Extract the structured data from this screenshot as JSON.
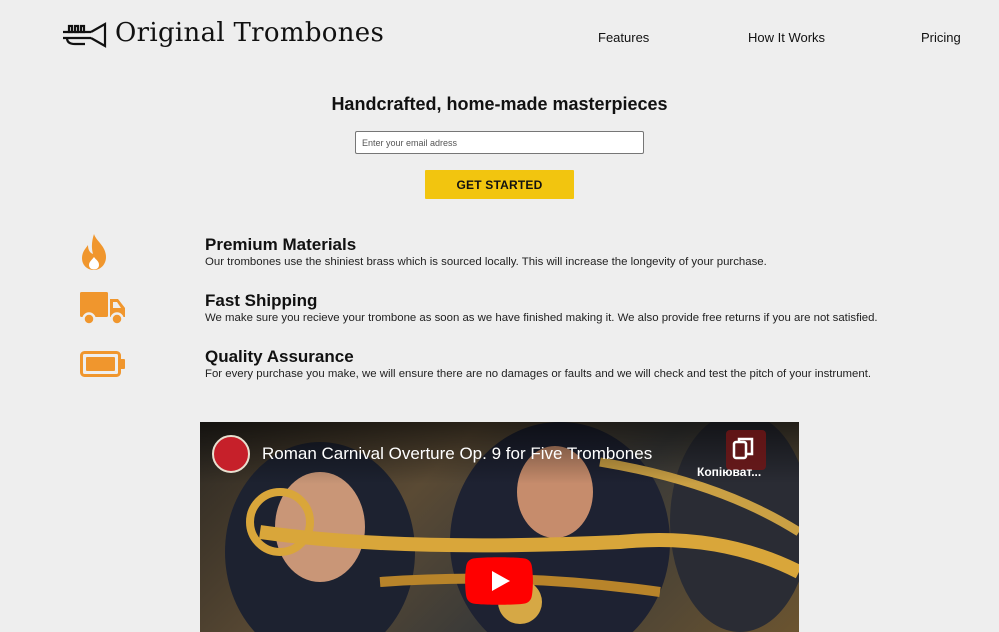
{
  "header": {
    "brand": "Original Trombones",
    "logo_icon": "trumpet-icon",
    "nav": [
      {
        "label": "Features"
      },
      {
        "label": "How It Works"
      },
      {
        "label": "Pricing"
      }
    ]
  },
  "hero": {
    "title": "Handcrafted, home-made masterpieces",
    "email_placeholder": "Enter your email adress",
    "cta_label": "GET STARTED",
    "cta_color": "#f2c50f"
  },
  "features": [
    {
      "icon": "fire-icon",
      "title": "Premium Materials",
      "description": "Our trombones use the shiniest brass which is sourced locally. This will increase the longevity of your purchase."
    },
    {
      "icon": "truck-icon",
      "title": "Fast Shipping",
      "description": "We make sure you recieve your trombone as soon as we have finished making it. We also provide free returns if you are not satisfied."
    },
    {
      "icon": "battery-icon",
      "title": "Quality Assurance",
      "description": "For every purchase you make, we will ensure there are no damages or faults and we will check and test the pitch of your instrument."
    }
  ],
  "accent_color": "#f0962d",
  "video": {
    "title": "Roman Carnival Overture Op. 9 for Five Trombones",
    "copy_label": "Копіюват...",
    "play_icon": "play-icon",
    "copy_icon": "copy-link-icon"
  }
}
